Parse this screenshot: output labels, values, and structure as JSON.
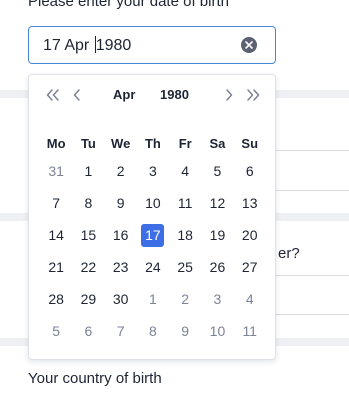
{
  "form": {
    "dob_label": "Please enter your date of birth",
    "dob_value": "17 Apr 1980",
    "hidden_question_fragment": "er?",
    "country_label": "Your country of birth"
  },
  "calendar": {
    "month": "Apr",
    "year": "1980",
    "nav_icons": [
      "double-chevron-left",
      "chevron-left",
      "chevron-right",
      "double-chevron-right"
    ],
    "weekdays": [
      "Mo",
      "Tu",
      "We",
      "Th",
      "Fr",
      "Sa",
      "Su"
    ],
    "weeks": [
      [
        {
          "d": "31",
          "m": true
        },
        {
          "d": "1"
        },
        {
          "d": "2"
        },
        {
          "d": "3"
        },
        {
          "d": "4"
        },
        {
          "d": "5"
        },
        {
          "d": "6"
        }
      ],
      [
        {
          "d": "7"
        },
        {
          "d": "8"
        },
        {
          "d": "9"
        },
        {
          "d": "10"
        },
        {
          "d": "11"
        },
        {
          "d": "12"
        },
        {
          "d": "13"
        }
      ],
      [
        {
          "d": "14"
        },
        {
          "d": "15"
        },
        {
          "d": "16"
        },
        {
          "d": "17",
          "sel": true
        },
        {
          "d": "18"
        },
        {
          "d": "19"
        },
        {
          "d": "20"
        }
      ],
      [
        {
          "d": "21"
        },
        {
          "d": "22"
        },
        {
          "d": "23"
        },
        {
          "d": "24"
        },
        {
          "d": "25"
        },
        {
          "d": "26"
        },
        {
          "d": "27"
        }
      ],
      [
        {
          "d": "28"
        },
        {
          "d": "29"
        },
        {
          "d": "30"
        },
        {
          "d": "1",
          "m": true
        },
        {
          "d": "2",
          "m": true
        },
        {
          "d": "3",
          "m": true
        },
        {
          "d": "4",
          "m": true
        }
      ],
      [
        {
          "d": "5",
          "m": true
        },
        {
          "d": "6",
          "m": true
        },
        {
          "d": "7",
          "m": true
        },
        {
          "d": "8",
          "m": true
        },
        {
          "d": "9",
          "m": true
        },
        {
          "d": "10",
          "m": true
        },
        {
          "d": "11",
          "m": true
        }
      ]
    ]
  },
  "colors": {
    "accent": "#3d6ee6",
    "input_border": "#4a86d8",
    "muted_text": "#7c8396",
    "text": "#1e2433"
  }
}
